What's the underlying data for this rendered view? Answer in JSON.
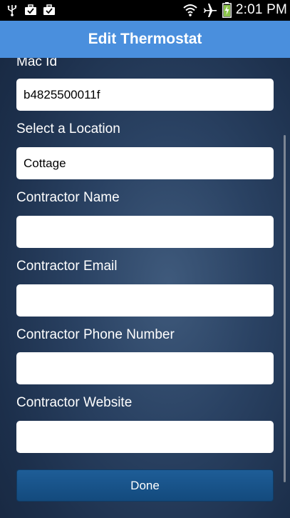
{
  "status_bar": {
    "time": "2:01 PM",
    "left_icons": [
      "usb-icon",
      "briefcase-check-icon",
      "briefcase-check-icon"
    ],
    "right_icons": [
      "wifi-icon",
      "airplane-icon",
      "battery-charging-icon"
    ]
  },
  "header": {
    "title": "Edit Thermostat"
  },
  "form": {
    "mac_label": "Mac Id",
    "mac_value": "b4825500011f",
    "location_label": "Select a Location",
    "location_value": "Cottage",
    "contractor_name_label": "Contractor Name",
    "contractor_name_value": "",
    "contractor_email_label": "Contractor Email",
    "contractor_email_value": "",
    "contractor_phone_label": "Contractor Phone Number",
    "contractor_phone_value": "",
    "contractor_website_label": "Contractor Website",
    "contractor_website_value": "",
    "done_label": "Done"
  },
  "colors": {
    "action_bar": "#4a8fdd",
    "background": "#1f3351",
    "done_button": "#1a5690"
  }
}
